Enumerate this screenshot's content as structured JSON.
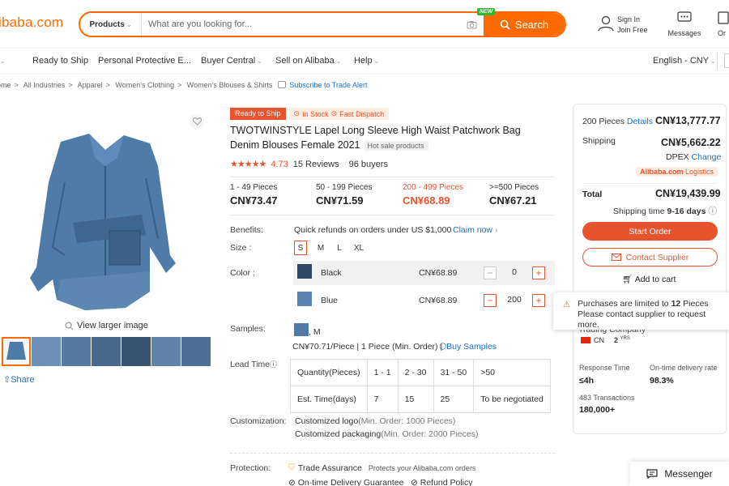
{
  "header": {
    "logo": "ibaba.com",
    "search": {
      "category": "Products",
      "placeholder": "What are you looking for...",
      "new_badge": "NEW",
      "button": "Search"
    },
    "sign_in": "Sign In",
    "join_free": "Join Free",
    "messages": "Messages",
    "orders": "Or"
  },
  "nav": {
    "items": [
      "Ready to Ship",
      "Personal Protective E...",
      "Buyer Central",
      "Sell on Alibaba",
      "Help"
    ],
    "language": "English - CNY"
  },
  "breadcrumb": [
    "ome",
    "All Industries",
    "Apparel",
    "Women's Clothing",
    "Women's Blouses & Shirts"
  ],
  "subscribe": "Subscribe to Trade Alert",
  "gallery": {
    "view_larger": "View larger image",
    "share": "Share"
  },
  "product": {
    "tag_ready": "Ready to Ship",
    "tag_stock": "In Stock",
    "tag_dispatch": "Fast Dispatch",
    "title": "TWOTWINSTYLE Lapel Long Sleeve High Waist Patchwork Bag Denim Blouses Female 2021",
    "hot_sale": "Hot sale products",
    "rating": "4.73",
    "rating_stars": 4.73,
    "reviews": "15 Reviews",
    "buyers": "96 buyers",
    "tiers": [
      {
        "range": "1 - 49 Pieces",
        "price": "CN¥73.47"
      },
      {
        "range": "50 - 199 Pieces",
        "price": "CN¥71.59"
      },
      {
        "range": "200 - 499 Pieces",
        "price": "CN¥68.89"
      },
      {
        "range": ">=500 Pieces",
        "price": "CN¥67.21"
      }
    ],
    "benefits_label": "Benefits:",
    "benefits_text": "Quick refunds on orders under US $1,000",
    "claim_now": "Claim now",
    "size_label": "Size :",
    "sizes": [
      "S",
      "M",
      "L",
      "XL"
    ],
    "color_label": "Color :",
    "colors": [
      {
        "name": "Black",
        "price": "CN¥68.89",
        "qty": "0"
      },
      {
        "name": "Blue",
        "price": "CN¥68.89",
        "qty": "200"
      }
    ],
    "samples_label": "Samples:",
    "sample_size": ", M",
    "sample_price": "CN¥70.71/Piece | 1 Piece (Min. Order) |",
    "buy_samples": "Buy Samples",
    "lead_label": "Lead Time",
    "lead_table": {
      "row1": [
        "Quantity(Pieces)",
        "1 - 1",
        "2 - 30",
        "31 - 50",
        ">50"
      ],
      "row2": [
        "Est. Time(days)",
        "7",
        "15",
        "25",
        "To be negotiated"
      ]
    },
    "customization_label": "Customization:",
    "custom_logo": "Customized logo",
    "custom_logo_min": "(Min. Order: 1000 Pieces)",
    "custom_pack": "Customized packaging",
    "custom_pack_min": "(Min. Order: 2000 Pieces)",
    "protection_label": "Protection:",
    "trade_assurance": "Trade Assurance",
    "trade_desc": "Protects your Alibaba.com orders",
    "ontime": "On-time Delivery Guarantee",
    "refund": "Refund Policy"
  },
  "order_panel": {
    "pieces": "200 Pieces",
    "details": "Details",
    "subtotal": "CN¥13,777.77",
    "shipping_label": "Shipping",
    "shipping_cost": "CN¥5,662.22",
    "carrier": "DPEX",
    "change": "Change",
    "logistics_brand": "Alibaba.com",
    "logistics_word": "Logistics",
    "total_label": "Total",
    "total": "CN¥19,439.99",
    "shipping_time": "Shipping time",
    "shipping_days": "9-16 days",
    "start_order": "Start Order",
    "contact_supplier": "Contact Supplier",
    "add_to_cart": "Add to cart"
  },
  "tooltip": {
    "line1_pre": "Purchases are limited to",
    "line1_num": "12",
    "line1_post": "Pieces",
    "line2": "Please contact supplier to request more."
  },
  "supplier": {
    "company_fragment": "Trading Company",
    "country": "CN",
    "years": "2",
    "years_unit": "YRS",
    "response_label": "Response Time",
    "response_value": "≤4h",
    "ontime_label": "On-time delivery rate",
    "ontime_value": "98.3%",
    "transactions_label": "483 Transactions",
    "transactions_value": "180,000+"
  },
  "messenger": "Messenger",
  "colors": {
    "accent": "#ff6a00",
    "price_accent": "#e8532f",
    "link": "#1a6fc9",
    "denim": "#4b6f9a"
  }
}
